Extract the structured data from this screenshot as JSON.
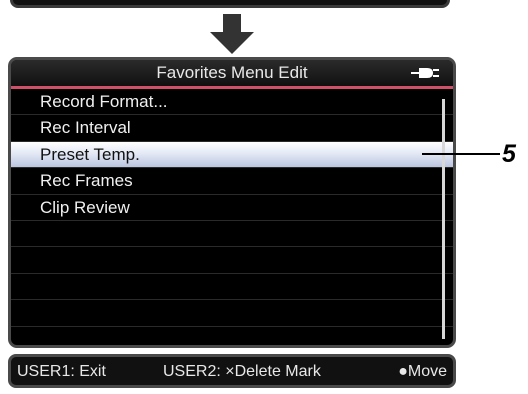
{
  "screen": {
    "title": "Favorites Menu Edit",
    "battery_icon": "battery-power-icon",
    "items": [
      {
        "label": "Record Format..."
      },
      {
        "label": "Rec Interval"
      },
      {
        "label": "Preset Temp.",
        "selected": true
      },
      {
        "label": "Rec Frames"
      },
      {
        "label": "Clip Review"
      },
      {
        "label": ""
      },
      {
        "label": ""
      },
      {
        "label": ""
      },
      {
        "label": ""
      },
      {
        "label": ""
      }
    ]
  },
  "callout": {
    "number": "5"
  },
  "footer": {
    "exit": "USER1: Exit",
    "delete": "USER2: ×Delete Mark",
    "move": "●Move"
  },
  "colors": {
    "accent_line": "#d0506a",
    "selection_top": "#ffffff",
    "selection_bottom": "#b9c4de"
  }
}
